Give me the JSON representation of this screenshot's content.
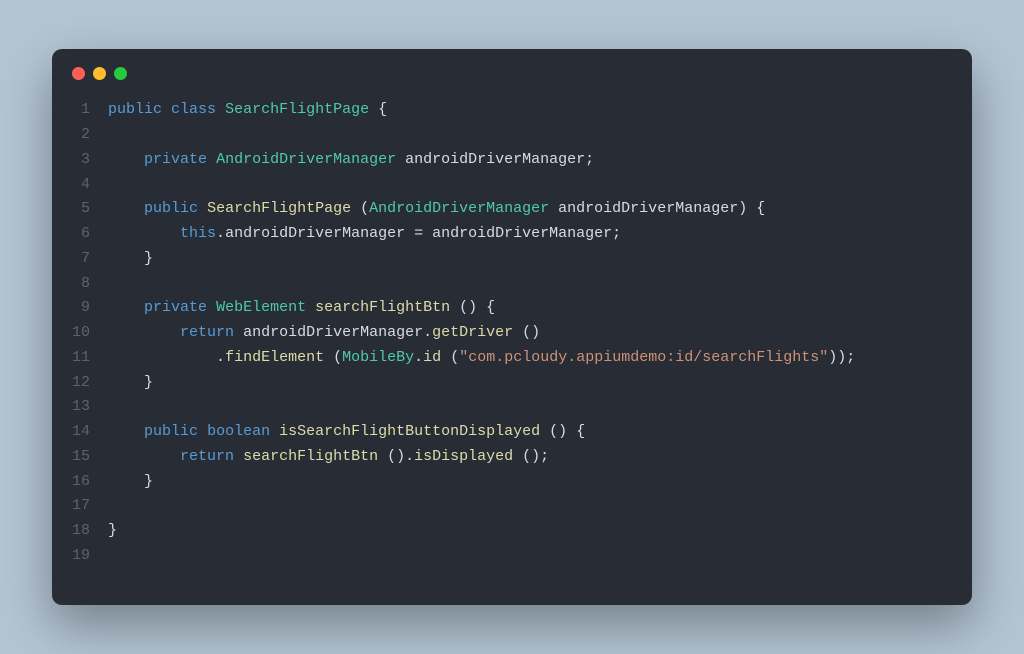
{
  "window": {
    "traffic_lights": [
      "close",
      "minimize",
      "maximize"
    ]
  },
  "code": {
    "line_numbers": [
      "1",
      "2",
      "3",
      "4",
      "5",
      "6",
      "7",
      "8",
      "9",
      "10",
      "11",
      "12",
      "13",
      "14",
      "15",
      "16",
      "17",
      "18",
      "19"
    ],
    "lines": [
      {
        "indent": "",
        "tokens": [
          {
            "t": "kw",
            "v": "public"
          },
          {
            "t": "sp",
            "v": " "
          },
          {
            "t": "kw",
            "v": "class"
          },
          {
            "t": "sp",
            "v": " "
          },
          {
            "t": "type",
            "v": "SearchFlightPage"
          },
          {
            "t": "sp",
            "v": " "
          },
          {
            "t": "punct",
            "v": "{"
          }
        ]
      },
      {
        "indent": "",
        "tokens": []
      },
      {
        "indent": "    ",
        "tokens": [
          {
            "t": "kw",
            "v": "private"
          },
          {
            "t": "sp",
            "v": " "
          },
          {
            "t": "type",
            "v": "AndroidDriverManager"
          },
          {
            "t": "sp",
            "v": " "
          },
          {
            "t": "ident",
            "v": "androidDriverManager"
          },
          {
            "t": "punct",
            "v": ";"
          }
        ]
      },
      {
        "indent": "",
        "tokens": []
      },
      {
        "indent": "    ",
        "tokens": [
          {
            "t": "kw",
            "v": "public"
          },
          {
            "t": "sp",
            "v": " "
          },
          {
            "t": "method",
            "v": "SearchFlightPage"
          },
          {
            "t": "sp",
            "v": " "
          },
          {
            "t": "punct",
            "v": "("
          },
          {
            "t": "type",
            "v": "AndroidDriverManager"
          },
          {
            "t": "sp",
            "v": " "
          },
          {
            "t": "ident",
            "v": "androidDriverManager"
          },
          {
            "t": "punct",
            "v": ")"
          },
          {
            "t": "sp",
            "v": " "
          },
          {
            "t": "punct",
            "v": "{"
          }
        ]
      },
      {
        "indent": "        ",
        "tokens": [
          {
            "t": "kw",
            "v": "this"
          },
          {
            "t": "punct",
            "v": "."
          },
          {
            "t": "ident",
            "v": "androidDriverManager"
          },
          {
            "t": "sp",
            "v": " "
          },
          {
            "t": "punct",
            "v": "="
          },
          {
            "t": "sp",
            "v": " "
          },
          {
            "t": "ident",
            "v": "androidDriverManager"
          },
          {
            "t": "punct",
            "v": ";"
          }
        ]
      },
      {
        "indent": "    ",
        "tokens": [
          {
            "t": "punct",
            "v": "}"
          }
        ]
      },
      {
        "indent": "",
        "tokens": []
      },
      {
        "indent": "    ",
        "tokens": [
          {
            "t": "kw",
            "v": "private"
          },
          {
            "t": "sp",
            "v": " "
          },
          {
            "t": "type",
            "v": "WebElement"
          },
          {
            "t": "sp",
            "v": " "
          },
          {
            "t": "method",
            "v": "searchFlightBtn"
          },
          {
            "t": "sp",
            "v": " "
          },
          {
            "t": "punct",
            "v": "()"
          },
          {
            "t": "sp",
            "v": " "
          },
          {
            "t": "punct",
            "v": "{"
          }
        ]
      },
      {
        "indent": "        ",
        "tokens": [
          {
            "t": "kw",
            "v": "return"
          },
          {
            "t": "sp",
            "v": " "
          },
          {
            "t": "ident",
            "v": "androidDriverManager"
          },
          {
            "t": "punct",
            "v": "."
          },
          {
            "t": "method",
            "v": "getDriver"
          },
          {
            "t": "sp",
            "v": " "
          },
          {
            "t": "punct",
            "v": "()"
          }
        ]
      },
      {
        "indent": "            ",
        "tokens": [
          {
            "t": "punct",
            "v": "."
          },
          {
            "t": "method",
            "v": "findElement"
          },
          {
            "t": "sp",
            "v": " "
          },
          {
            "t": "punct",
            "v": "("
          },
          {
            "t": "type",
            "v": "MobileBy"
          },
          {
            "t": "punct",
            "v": "."
          },
          {
            "t": "method",
            "v": "id"
          },
          {
            "t": "sp",
            "v": " "
          },
          {
            "t": "punct",
            "v": "("
          },
          {
            "t": "str",
            "v": "\"com.pcloudy.appiumdemo:id/searchFlights\""
          },
          {
            "t": "punct",
            "v": "));"
          }
        ]
      },
      {
        "indent": "    ",
        "tokens": [
          {
            "t": "punct",
            "v": "}"
          }
        ]
      },
      {
        "indent": "",
        "tokens": []
      },
      {
        "indent": "    ",
        "tokens": [
          {
            "t": "kw",
            "v": "public"
          },
          {
            "t": "sp",
            "v": " "
          },
          {
            "t": "kw",
            "v": "boolean"
          },
          {
            "t": "sp",
            "v": " "
          },
          {
            "t": "method",
            "v": "isSearchFlightButtonDisplayed"
          },
          {
            "t": "sp",
            "v": " "
          },
          {
            "t": "punct",
            "v": "()"
          },
          {
            "t": "sp",
            "v": " "
          },
          {
            "t": "punct",
            "v": "{"
          }
        ]
      },
      {
        "indent": "        ",
        "tokens": [
          {
            "t": "kw",
            "v": "return"
          },
          {
            "t": "sp",
            "v": " "
          },
          {
            "t": "method",
            "v": "searchFlightBtn"
          },
          {
            "t": "sp",
            "v": " "
          },
          {
            "t": "punct",
            "v": "()."
          },
          {
            "t": "method",
            "v": "isDisplayed"
          },
          {
            "t": "sp",
            "v": " "
          },
          {
            "t": "punct",
            "v": "();"
          }
        ]
      },
      {
        "indent": "    ",
        "tokens": [
          {
            "t": "punct",
            "v": "}"
          }
        ]
      },
      {
        "indent": "",
        "tokens": []
      },
      {
        "indent": "",
        "tokens": [
          {
            "t": "punct",
            "v": "}"
          }
        ]
      },
      {
        "indent": "",
        "tokens": []
      }
    ]
  }
}
